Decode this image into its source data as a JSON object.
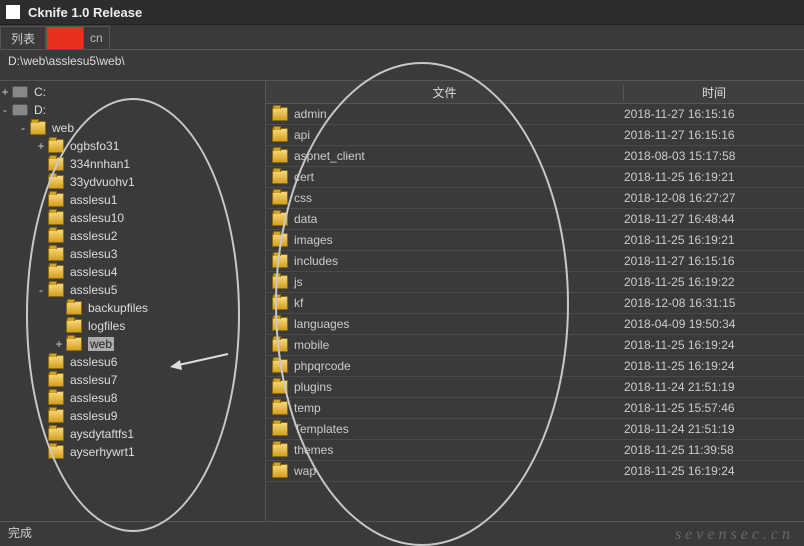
{
  "title": "Cknife 1.0 Release",
  "tabs": {
    "list": "列表",
    "redacted": " ",
    "suffix": "cn"
  },
  "path": "D:\\web\\asslesu5\\web\\",
  "file_header": {
    "name": "文件",
    "time": "时间"
  },
  "tree": [
    {
      "depth": 0,
      "exp": "+",
      "kind": "drive",
      "label": "C:"
    },
    {
      "depth": 0,
      "exp": "-",
      "kind": "drive",
      "label": "D:"
    },
    {
      "depth": 1,
      "exp": "-",
      "kind": "folder",
      "label": "web"
    },
    {
      "depth": 2,
      "exp": "+",
      "kind": "folder",
      "label": "ogbsfo31"
    },
    {
      "depth": 2,
      "exp": "",
      "kind": "folder",
      "label": "334nnhan1"
    },
    {
      "depth": 2,
      "exp": "",
      "kind": "folder",
      "label": "33ydvuohv1"
    },
    {
      "depth": 2,
      "exp": "",
      "kind": "folder",
      "label": "asslesu1"
    },
    {
      "depth": 2,
      "exp": "",
      "kind": "folder",
      "label": "asslesu10"
    },
    {
      "depth": 2,
      "exp": "",
      "kind": "folder",
      "label": "asslesu2"
    },
    {
      "depth": 2,
      "exp": "",
      "kind": "folder",
      "label": "asslesu3"
    },
    {
      "depth": 2,
      "exp": "",
      "kind": "folder",
      "label": "asslesu4"
    },
    {
      "depth": 2,
      "exp": "-",
      "kind": "folder",
      "label": "asslesu5"
    },
    {
      "depth": 3,
      "exp": "",
      "kind": "folder",
      "label": "backupfiles"
    },
    {
      "depth": 3,
      "exp": "",
      "kind": "folder",
      "label": "logfiles"
    },
    {
      "depth": 3,
      "exp": "+",
      "kind": "folder",
      "label": "web",
      "selected": true
    },
    {
      "depth": 2,
      "exp": "",
      "kind": "folder",
      "label": "asslesu6"
    },
    {
      "depth": 2,
      "exp": "",
      "kind": "folder",
      "label": "asslesu7"
    },
    {
      "depth": 2,
      "exp": "",
      "kind": "folder",
      "label": "asslesu8"
    },
    {
      "depth": 2,
      "exp": "",
      "kind": "folder",
      "label": "asslesu9"
    },
    {
      "depth": 2,
      "exp": "",
      "kind": "folder",
      "label": "aysdytaftfs1"
    },
    {
      "depth": 2,
      "exp": "",
      "kind": "folder",
      "label": "ayserhywrt1"
    }
  ],
  "files": [
    {
      "name": "admin",
      "time": "2018-11-27 16:15:16"
    },
    {
      "name": "api",
      "time": "2018-11-27 16:15:16"
    },
    {
      "name": "aspnet_client",
      "time": "2018-08-03 15:17:58"
    },
    {
      "name": "cert",
      "time": "2018-11-25 16:19:21"
    },
    {
      "name": "css",
      "time": "2018-12-08 16:27:27"
    },
    {
      "name": "data",
      "time": "2018-11-27 16:48:44"
    },
    {
      "name": "images",
      "time": "2018-11-25 16:19:21"
    },
    {
      "name": "includes",
      "time": "2018-11-27 16:15:16"
    },
    {
      "name": "js",
      "time": "2018-11-25 16:19:22"
    },
    {
      "name": "kf",
      "time": "2018-12-08 16:31:15"
    },
    {
      "name": "languages",
      "time": "2018-04-09 19:50:34"
    },
    {
      "name": "mobile",
      "time": "2018-11-25 16:19:24"
    },
    {
      "name": "phpqrcode",
      "time": "2018-11-25 16:19:24"
    },
    {
      "name": "plugins",
      "time": "2018-11-24 21:51:19"
    },
    {
      "name": "temp",
      "time": "2018-11-25 15:57:46"
    },
    {
      "name": "Templates",
      "time": "2018-11-24 21:51:19"
    },
    {
      "name": "themes",
      "time": "2018-11-25 11:39:58"
    },
    {
      "name": "wap",
      "time": "2018-11-25 16:19:24"
    }
  ],
  "status": "完成",
  "watermark": "sevensec.cn"
}
